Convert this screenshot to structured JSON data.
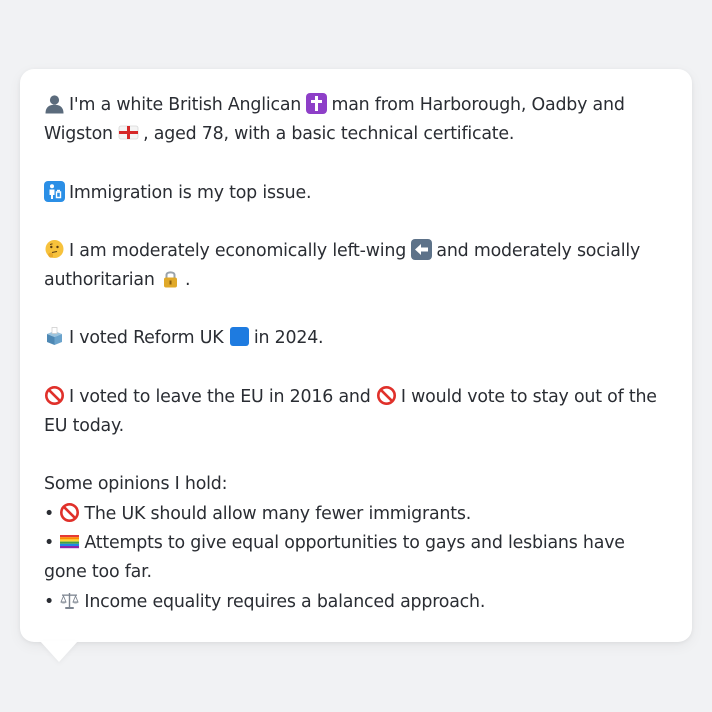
{
  "message": {
    "identity": {
      "part1": "I'm a white British Anglican",
      "part2": "man from Harborough, Oadby and Wigston",
      "part3": ", aged 78, with a basic technical certificate.",
      "icons": [
        "person-silhouette-icon",
        "latin-cross-icon",
        "england-flag-icon"
      ]
    },
    "top_issue": {
      "text": "Immigration is my top issue.",
      "icon": "passport-control-icon"
    },
    "politics": {
      "part1": "I am moderately economically left-wing",
      "part2": "and moderately socially authoritarian",
      "part3": ".",
      "icons": [
        "thinking-face-icon",
        "left-arrow-icon",
        "locked-padlock-icon"
      ]
    },
    "vote_2024": {
      "part1": "I voted Reform UK",
      "part2": "in 2024.",
      "icons": [
        "ballot-box-icon",
        "blue-square-icon"
      ]
    },
    "eu": {
      "part1": "I voted to leave the EU in 2016 and",
      "part2": "I would vote to stay out of the EU today.",
      "icons": [
        "prohibited-icon",
        "prohibited-icon"
      ]
    },
    "opinions": {
      "heading": "Some opinions I hold:",
      "bullet": "•",
      "items": [
        {
          "text": "The UK should allow many fewer immigrants.",
          "icon": "prohibited-icon"
        },
        {
          "text": "Attempts to give equal opportunities to gays and lesbians have gone too far.",
          "icon": "rainbow-flag-icon"
        },
        {
          "text": "Income equality requires a balanced approach.",
          "icon": "balance-scale-icon"
        }
      ]
    }
  },
  "colors": {
    "background": "#f1f2f4",
    "bubble": "#ffffff",
    "text": "#2a2d33"
  }
}
